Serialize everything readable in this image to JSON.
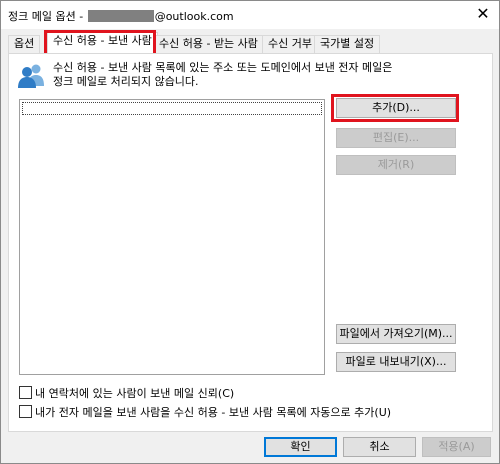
{
  "window": {
    "title_prefix": "정크 메일 옵션 -",
    "title_suffix": "@outlook.com",
    "close_glyph": "✕"
  },
  "tabs": [
    {
      "label": "옵션"
    },
    {
      "label": "수신 허용 - 보낸 사람",
      "active": true
    },
    {
      "label": "수신 허용 - 받는 사람"
    },
    {
      "label": "수신 거부"
    },
    {
      "label": "국가별 설정"
    }
  ],
  "info": {
    "icon": "people-icon",
    "line1": "수신 허용 - 보낸 사람 목록에 있는 주소 또는 도메인에서 보낸 전자 메일은",
    "line2": "정크 메일로 처리되지 않습니다."
  },
  "list": {
    "items": []
  },
  "side_buttons": {
    "add": "추가(D)...",
    "edit": "편집(E)...",
    "remove": "제거(R)",
    "import": "파일에서 가져오기(M)...",
    "export": "파일로 내보내기(X)..."
  },
  "checkboxes": {
    "trust_contacts": "내 연락처에 있는 사람이 보낸 메일 신뢰(C)",
    "auto_add": "내가 전자 메일을 보낸 사람을 수신 허용 - 보낸 사람 목록에 자동으로 추가(U)"
  },
  "footer": {
    "ok": "확인",
    "cancel": "취소",
    "apply": "적용(A)"
  },
  "colors": {
    "highlight": "#e0141e",
    "accent": "#0078d7"
  }
}
